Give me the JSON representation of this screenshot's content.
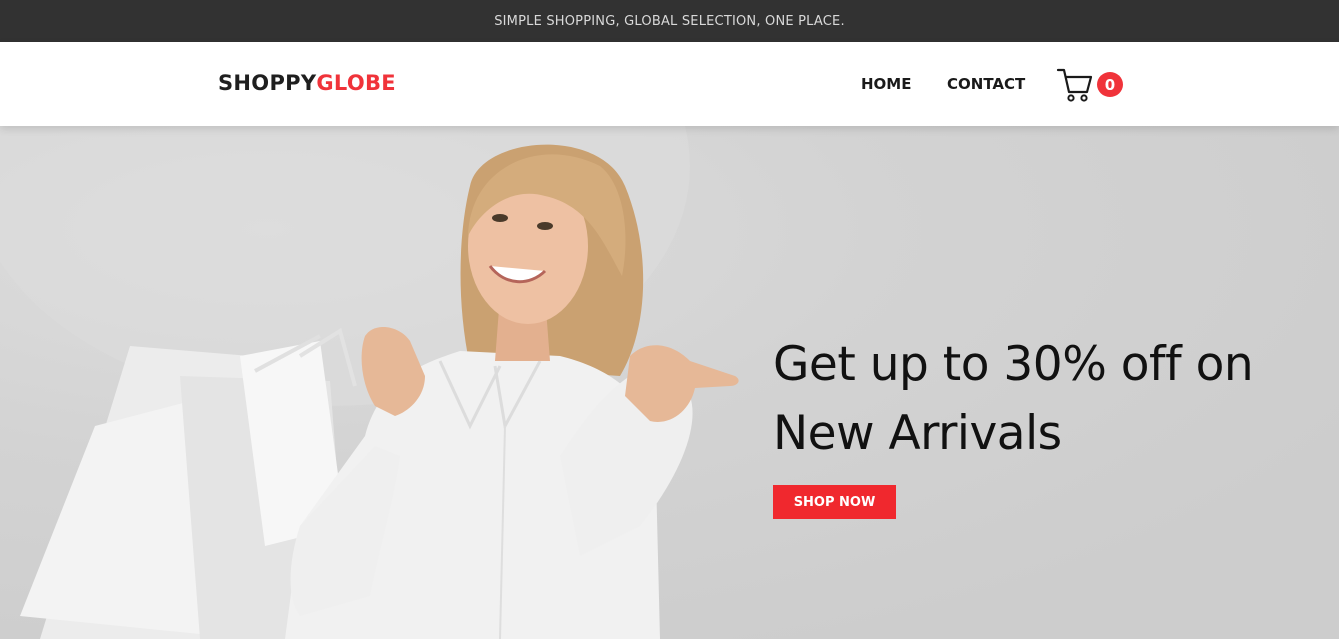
{
  "topbar": {
    "announcement": "SIMPLE SHOPPING, GLOBAL SELECTION, ONE PLACE."
  },
  "header": {
    "logo_part1": "SHOPPY",
    "logo_part2": "GLOBE",
    "nav": [
      {
        "label": "HOME"
      },
      {
        "label": "CONTACT"
      }
    ],
    "cart": {
      "icon": "shopping-cart-icon",
      "count": "0"
    }
  },
  "hero": {
    "headline_line1": "Get up to 30% off on",
    "headline_line2": "New Arrivals",
    "cta_label": "SHOP NOW",
    "image": "woman-with-shopping-bags"
  },
  "colors": {
    "topbar_bg": "#323232",
    "accent": "#f0333a",
    "hero_bg": "#cfcfcf",
    "text_dark": "#1a1a1a"
  }
}
